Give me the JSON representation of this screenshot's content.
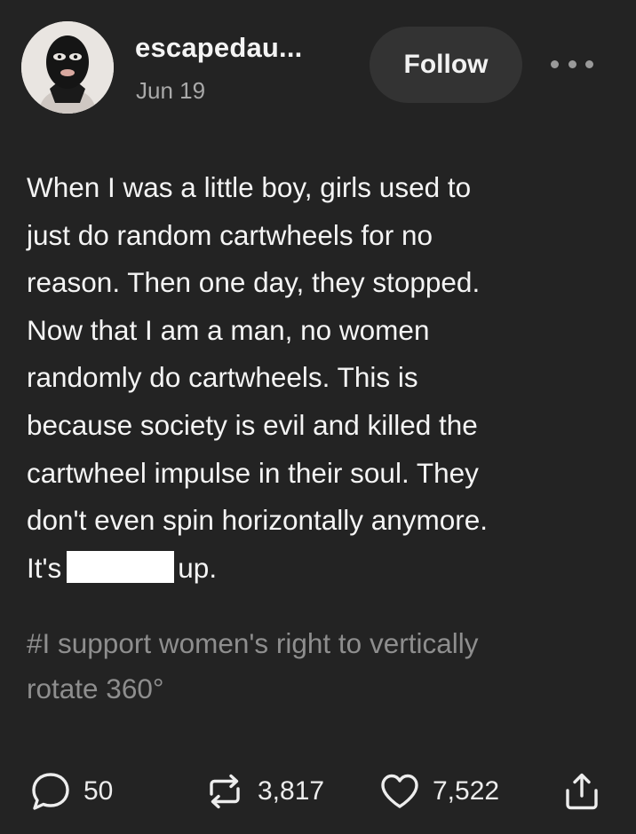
{
  "post": {
    "author": {
      "username": "escapedau...",
      "date": "Jun 19",
      "avatar_icon": "masked-man-avatar"
    },
    "follow_label": "Follow",
    "more_icon": "ellipsis-icon",
    "body_lines": [
      "When I was a little boy, girls used to",
      "just do random cartwheels for no",
      "reason. Then one day, they stopped.",
      "Now that I am a man, no women",
      "randomly do cartwheels. This is",
      "because society is evil and killed the",
      "cartwheel impulse in their soul. They",
      "don't even spin horizontally anymore."
    ],
    "last_line_before": "It's",
    "last_line_after": "up.",
    "tags_line1": "#I support women's right to vertically",
    "tags_line2": "rotate 360°"
  },
  "actions": {
    "comments": "50",
    "reblogs": "3,817",
    "likes": "7,522"
  },
  "colors": {
    "background": "#232323",
    "follow_button": "#333333",
    "text": "#f4f4f4",
    "muted": "#8e8e8e",
    "redaction": "#ffffff"
  }
}
